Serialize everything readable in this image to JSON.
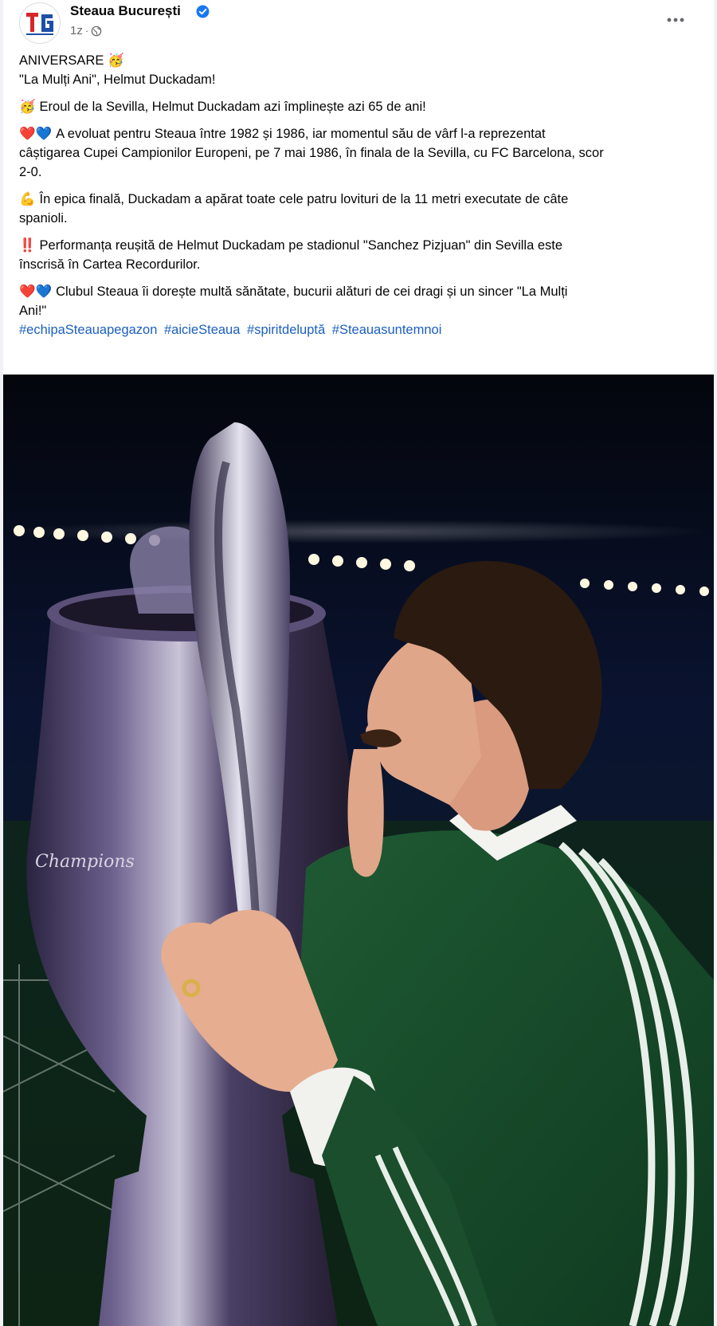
{
  "post": {
    "page_name": "Steaua București",
    "timestamp": "1z",
    "separator": "·",
    "avatar_logo_text": "TG",
    "icons": {
      "verified": "verified-badge-icon",
      "audience": "globe-icon",
      "more": "more-options-icon"
    },
    "accent_color": "#1877f2",
    "hashtag_color": "#1b5fbf"
  },
  "body": {
    "p1_line1": "ANIVERSARE 🥳",
    "p1_line2": "\"La Mulți Ani\", Helmut Duckadam!",
    "p2_emoji": "🥳",
    "p2_line1": "Eroul de la Sevilla, Helmut Duckadam azi împlinește azi 65 de ani!",
    "p3_emoji": "❤️💙",
    "p3_line1": "A evoluat pentru Steaua între 1982 și 1986, iar momentul său de vârf l-a reprezentat",
    "p3_line2": "câștigarea Cupei Campionilor Europeni, pe 7 mai 1986, în finala de la Sevilla, cu FC Barcelona, scor",
    "p3_line3": "2-0.",
    "p4_emoji": "💪",
    "p4_line1": "În epica finală, Duckadam a apărat toate cele patru lovituri de la 11 metri executate de câte",
    "p4_line2": "spanioli.",
    "p5_emoji": "‼️",
    "p5_line1": "Performanța reușită de Helmut Duckadam pe stadionul \"Sanchez Pizjuan\" din Sevilla este",
    "p5_line2": "înscrisă în Cartea Recordurilor.",
    "p6_emoji": "❤️💙",
    "p6_line1": "Clubul Steaua îi dorește multă sănătate, bucurii alături de cei dragi și un sincer \"La Mulți",
    "p6_line2": "Ani!\"",
    "hashtags": [
      "#echipaSteauapegazon",
      "#aicieSteaua",
      "#spiritdeluptă",
      "#Steauasuntemnoi"
    ]
  },
  "photo": {
    "trophy_engraving": "Champions",
    "description_icon": "photo"
  }
}
